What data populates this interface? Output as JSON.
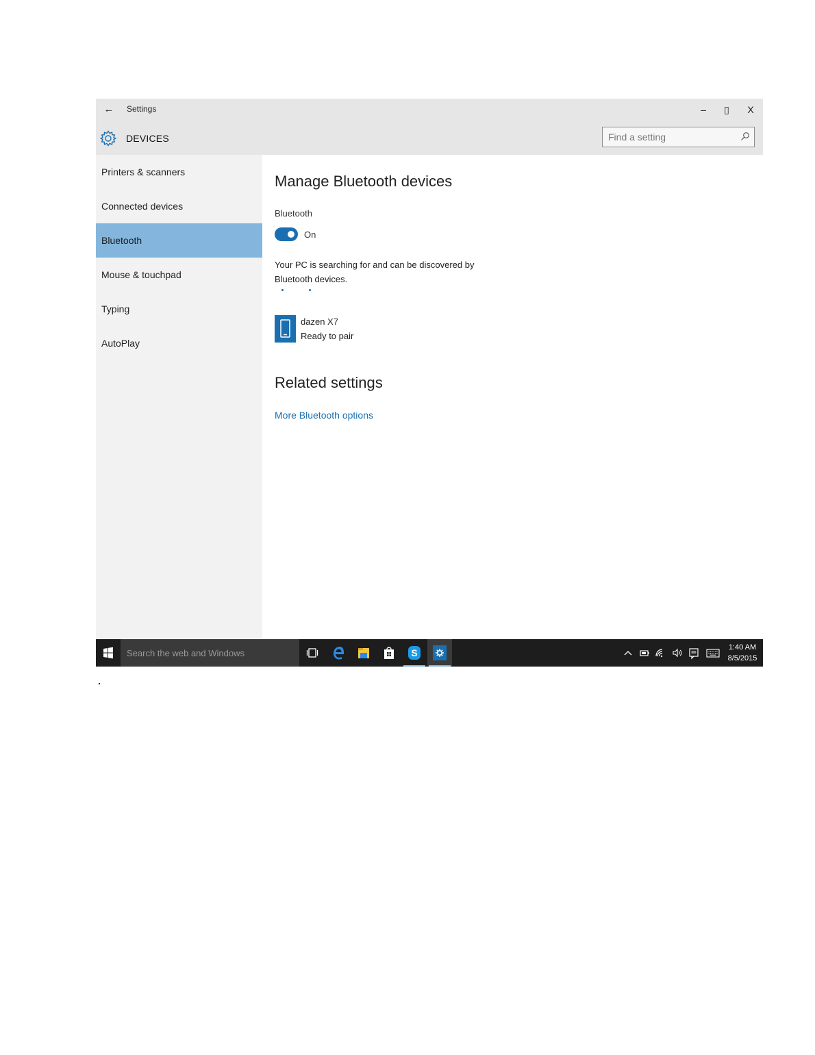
{
  "window": {
    "title": "Settings",
    "back_icon": "back-arrow-icon",
    "controls": {
      "minimize": "–",
      "maximize": "▯",
      "close": "X"
    }
  },
  "header": {
    "section_title": "DEVICES",
    "section_icon": "gear-icon",
    "search_placeholder": "Find a setting",
    "search_icon": "search-icon"
  },
  "sidebar": {
    "items": [
      {
        "label": "Printers & scanners",
        "selected": false
      },
      {
        "label": "Connected devices",
        "selected": false
      },
      {
        "label": "Bluetooth",
        "selected": true
      },
      {
        "label": "Mouse & touchpad",
        "selected": false
      },
      {
        "label": "Typing",
        "selected": false
      },
      {
        "label": "AutoPlay",
        "selected": false
      }
    ]
  },
  "main": {
    "title": "Manage Bluetooth devices",
    "bluetooth_label": "Bluetooth",
    "toggle_state": "On",
    "toggle_on": true,
    "description": "Your PC is searching for and can be discovered by Bluetooth devices.",
    "devices": [
      {
        "name": "dazen X7",
        "status": "Ready to pair",
        "icon": "phone-icon"
      }
    ],
    "related_title": "Related settings",
    "related_link": "More Bluetooth options"
  },
  "taskbar": {
    "search_text": "Search the web and Windows",
    "apps": [
      "task-view-icon",
      "edge-icon",
      "file-explorer-icon",
      "store-icon",
      "skype-icon",
      "settings-icon"
    ],
    "tray": [
      "chevron-up-icon",
      "battery-icon",
      "wifi-icon",
      "volume-icon",
      "notifications-icon",
      "keyboard-icon"
    ],
    "time": "1:40 AM",
    "date": "8/5/2015"
  },
  "colors": {
    "accent": "#1a6fb0",
    "selected_nav": "#84b6dd",
    "titlebar": "#e6e6e6",
    "sidebar": "#f2f2f2",
    "taskbar": "#1d1d1d"
  }
}
